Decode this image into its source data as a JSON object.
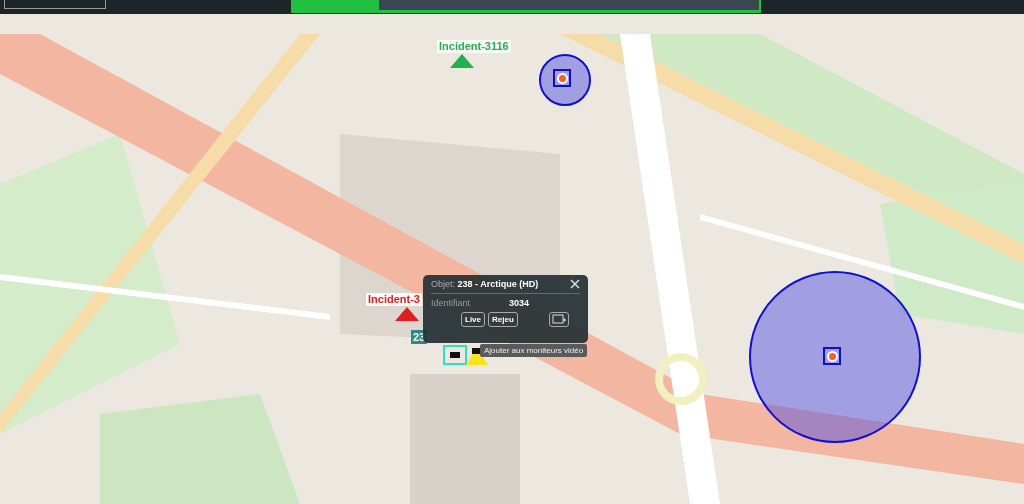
{
  "incidents": [
    {
      "label": "Incident-3116",
      "color": "#22b14c"
    },
    {
      "label": "Incident-3",
      "color": "#e02020"
    }
  ],
  "vehicle_label": "23",
  "popup": {
    "title": "Objet: **238 - Arctique (HD)**",
    "fields": [
      {
        "label": "Identifiant",
        "value": "3034"
      }
    ],
    "buttons": [
      "Live",
      "Rejeu"
    ],
    "tooltip": "Ajouter aux moniteurs vidéo"
  }
}
